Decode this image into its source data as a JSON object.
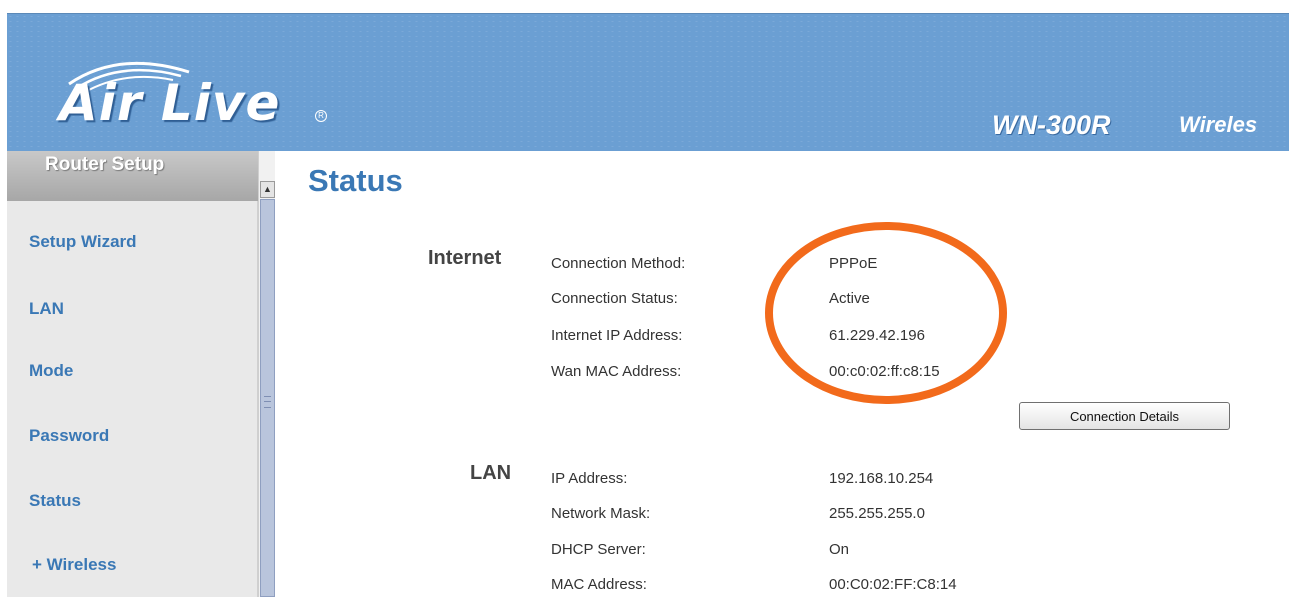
{
  "header": {
    "brand": "Air Live",
    "model": "WN-300R",
    "subtitle": "Wireles"
  },
  "sidebar": {
    "title": "Router Setup",
    "items": [
      {
        "label": "Setup Wizard"
      },
      {
        "label": "LAN"
      },
      {
        "label": "Mode"
      },
      {
        "label": "Password"
      },
      {
        "label": "Status"
      },
      {
        "label": "+ Wireless"
      }
    ]
  },
  "main": {
    "title": "Status",
    "internet": {
      "section_title": "Internet",
      "rows": [
        {
          "label": "Connection Method:",
          "value": "PPPoE"
        },
        {
          "label": "Connection Status:",
          "value": "Active"
        },
        {
          "label": "Internet IP Address:",
          "value": "61.229.42.196"
        },
        {
          "label": "Wan MAC Address:",
          "value": "00:c0:02:ff:c8:15"
        }
      ],
      "button_label": "Connection Details"
    },
    "lan": {
      "section_title": "LAN",
      "rows": [
        {
          "label": "IP Address:",
          "value": "192.168.10.254"
        },
        {
          "label": "Network Mask:",
          "value": "255.255.255.0"
        },
        {
          "label": "DHCP Server:",
          "value": "On"
        },
        {
          "label": "MAC Address:",
          "value": "00:C0:02:FF:C8:14"
        }
      ]
    }
  },
  "colors": {
    "header_bg": "#6b9fd3",
    "link": "#3a78b5",
    "highlight": "#f26a1b"
  },
  "icons": {
    "scroll_up": "chevron-up-icon"
  }
}
